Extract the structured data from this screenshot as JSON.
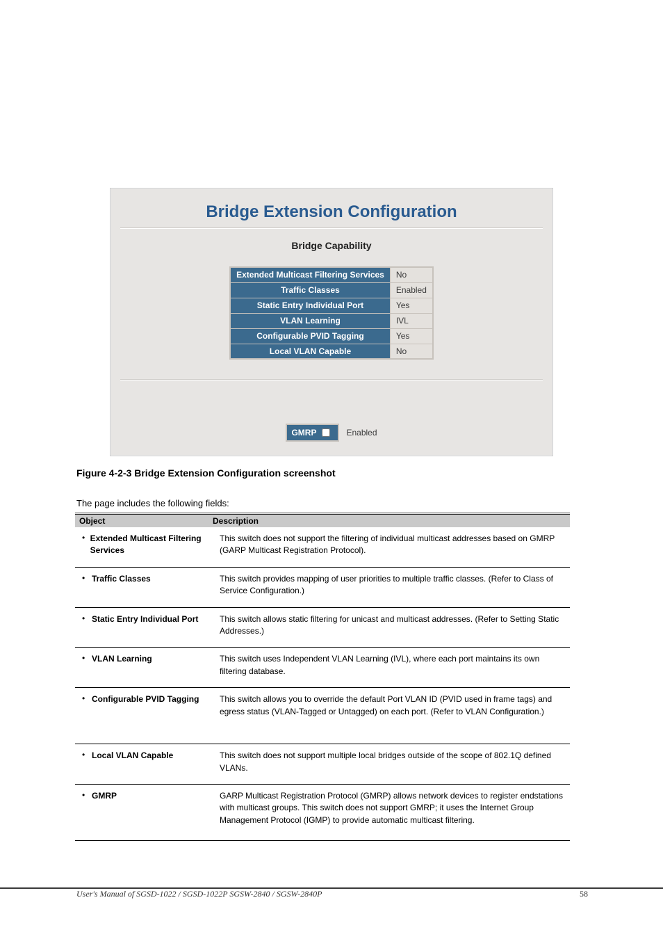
{
  "panel": {
    "title": "Bridge Extension Configuration",
    "subtitle": "Bridge Capability",
    "rows": [
      {
        "key": "Extended Multicast Filtering Services",
        "value": "No"
      },
      {
        "key": "Traffic Classes",
        "value": "Enabled"
      },
      {
        "key": "Static Entry Individual Port",
        "value": "Yes"
      },
      {
        "key": "VLAN Learning",
        "value": "IVL"
      },
      {
        "key": "Configurable PVID Tagging",
        "value": "Yes"
      },
      {
        "key": "Local VLAN Capable",
        "value": "No"
      }
    ],
    "gmrp_label": "GMRP",
    "gmrp_enabled_text": "Enabled"
  },
  "figure_caption": "Figure 4-2-3 Bridge Extension Configuration screenshot",
  "table": {
    "header_left": "Object",
    "header_right": "Description",
    "rows": [
      {
        "name": "Extended Multicast Filtering Services",
        "desc": "This switch does not support the filtering of individual multicast addresses based on GMRP (GARP Multicast Registration Protocol)."
      },
      {
        "name": "Traffic Classes",
        "desc": "This switch provides mapping of user priorities to multiple traffic classes. (Refer to Class of Service Configuration.)"
      },
      {
        "name": "Static Entry Individual Port",
        "desc": "This switch allows static filtering for unicast and multicast addresses. (Refer to Setting Static Addresses.)"
      },
      {
        "name": "VLAN Learning",
        "desc": "This switch uses Independent VLAN Learning (IVL), where each port maintains its own filtering database."
      },
      {
        "name": "Configurable PVID Tagging",
        "desc": "This switch allows you to override the default Port VLAN ID (PVID used in frame tags) and egress status (VLAN-Tagged or Untagged) on each port. (Refer to VLAN Configuration.)"
      },
      {
        "name": "Local VLAN Capable",
        "desc": "This switch does not support multiple local bridges outside of the scope of 802.1Q defined VLANs."
      },
      {
        "name": "GMRP",
        "desc": "GARP Multicast Registration Protocol (GMRP) allows network devices to register endstations with multicast groups. This switch does not support GMRP; it uses the Internet Group Management Protocol (IGMP) to provide automatic multicast filtering."
      }
    ]
  },
  "footer": {
    "left": "User's Manual of SGSD-1022 / SGSD-1022P  SGSW-2840 / SGSW-2840P",
    "right": "58"
  }
}
